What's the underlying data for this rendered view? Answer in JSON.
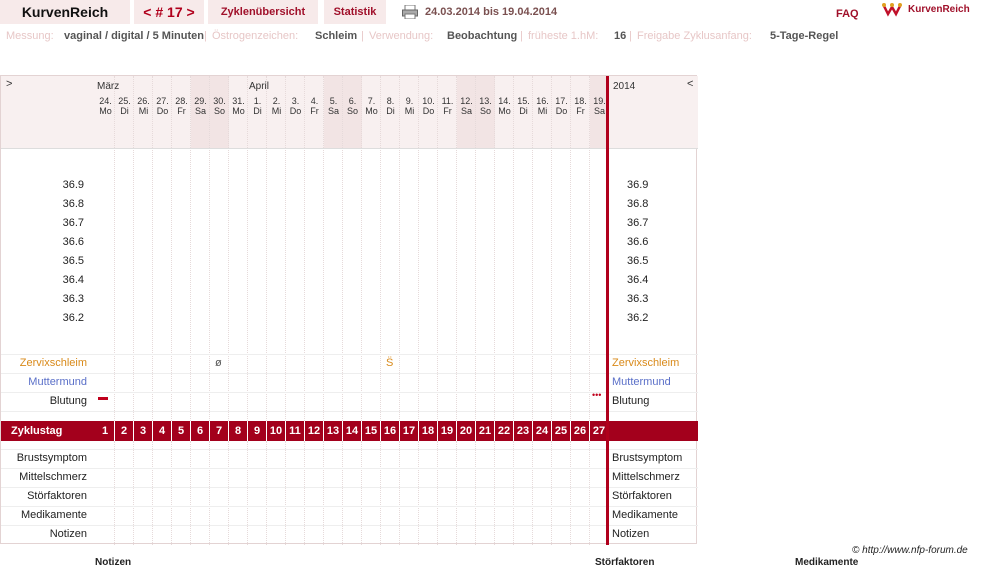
{
  "header": {
    "brand": "KurvenReich",
    "cycle_nav": "< # 17 >",
    "tab_overview": "Zyklenübersicht",
    "tab_stats": "Statistik",
    "date_range": "24.03.2014 bis 19.04.2014",
    "faq": "FAQ",
    "brand_right": "KurvenReich"
  },
  "info": {
    "messung_label": "Messung:",
    "messung_value": "vaginal / digital / 5 Minuten",
    "oestrogen_label": "Östrogenzeichen:",
    "oestrogen_value": "Schleim",
    "verwendung_label": "Verwendung:",
    "verwendung_value": "Beobachtung",
    "frueheste_label": "früheste 1.hM:",
    "frueheste_value": "16",
    "freigabe_label": "Freigabe Zyklusanfang:",
    "freigabe_value": "5-Tage-Regel"
  },
  "chart": {
    "nav_left": ">",
    "nav_right": "<",
    "year": "2014",
    "months": [
      {
        "name": "März"
      },
      {
        "name": "April"
      }
    ],
    "days": [
      {
        "date": "24.",
        "dow": "Mo",
        "weekend": false
      },
      {
        "date": "25.",
        "dow": "Di",
        "weekend": false
      },
      {
        "date": "26.",
        "dow": "Mi",
        "weekend": false
      },
      {
        "date": "27.",
        "dow": "Do",
        "weekend": false
      },
      {
        "date": "28.",
        "dow": "Fr",
        "weekend": false
      },
      {
        "date": "29.",
        "dow": "Sa",
        "weekend": true
      },
      {
        "date": "30.",
        "dow": "So",
        "weekend": true
      },
      {
        "date": "31.",
        "dow": "Mo",
        "weekend": false
      },
      {
        "date": "1.",
        "dow": "Di",
        "weekend": false
      },
      {
        "date": "2.",
        "dow": "Mi",
        "weekend": false
      },
      {
        "date": "3.",
        "dow": "Do",
        "weekend": false
      },
      {
        "date": "4.",
        "dow": "Fr",
        "weekend": false
      },
      {
        "date": "5.",
        "dow": "Sa",
        "weekend": true
      },
      {
        "date": "6.",
        "dow": "So",
        "weekend": true
      },
      {
        "date": "7.",
        "dow": "Mo",
        "weekend": false
      },
      {
        "date": "8.",
        "dow": "Di",
        "weekend": false
      },
      {
        "date": "9.",
        "dow": "Mi",
        "weekend": false
      },
      {
        "date": "10.",
        "dow": "Do",
        "weekend": false
      },
      {
        "date": "11.",
        "dow": "Fr",
        "weekend": false
      },
      {
        "date": "12.",
        "dow": "Sa",
        "weekend": true
      },
      {
        "date": "13.",
        "dow": "So",
        "weekend": true
      },
      {
        "date": "14.",
        "dow": "Mo",
        "weekend": false
      },
      {
        "date": "15.",
        "dow": "Di",
        "weekend": false
      },
      {
        "date": "16.",
        "dow": "Mi",
        "weekend": false
      },
      {
        "date": "17.",
        "dow": "Do",
        "weekend": false
      },
      {
        "date": "18.",
        "dow": "Fr",
        "weekend": false
      },
      {
        "date": "19.",
        "dow": "Sa",
        "weekend": true
      }
    ],
    "temperatures": [
      "36.9",
      "36.8",
      "36.7",
      "36.6",
      "36.5",
      "36.4",
      "36.3",
      "36.2"
    ],
    "rows": {
      "zervix": "Zervixschleim",
      "muttermund": "Muttermund",
      "blutung": "Blutung",
      "zyklustag": "Zyklustag",
      "brust": "Brustsymptom",
      "mittel": "Mittelschmerz",
      "stoer": "Störfaktoren",
      "medi": "Medikamente",
      "notizen": "Notizen"
    },
    "zervix_marks": [
      {
        "day": 7,
        "symbol": "ø"
      },
      {
        "day": 16,
        "symbol": "S̈"
      }
    ],
    "bleeding_marks": [
      {
        "day": 1,
        "symbol": "▬"
      },
      {
        "day": 27,
        "symbol": "•••"
      }
    ],
    "cycle_days": [
      "1",
      "2",
      "3",
      "4",
      "5",
      "6",
      "7",
      "8",
      "9",
      "10",
      "11",
      "12",
      "13",
      "14",
      "15",
      "16",
      "17",
      "18",
      "19",
      "20",
      "21",
      "22",
      "23",
      "24",
      "25",
      "26",
      "27"
    ],
    "colors": {
      "accent": "#a3001c",
      "zervix": "#d98a1a",
      "muttermund": "#5a6fc8",
      "weekend": "#f2e4e4"
    }
  },
  "footer": {
    "copyright": "© http://www.nfp-forum.de",
    "below_notizen": "Notizen",
    "below_stoer": "Störfaktoren",
    "below_medi": "Medikamente"
  }
}
